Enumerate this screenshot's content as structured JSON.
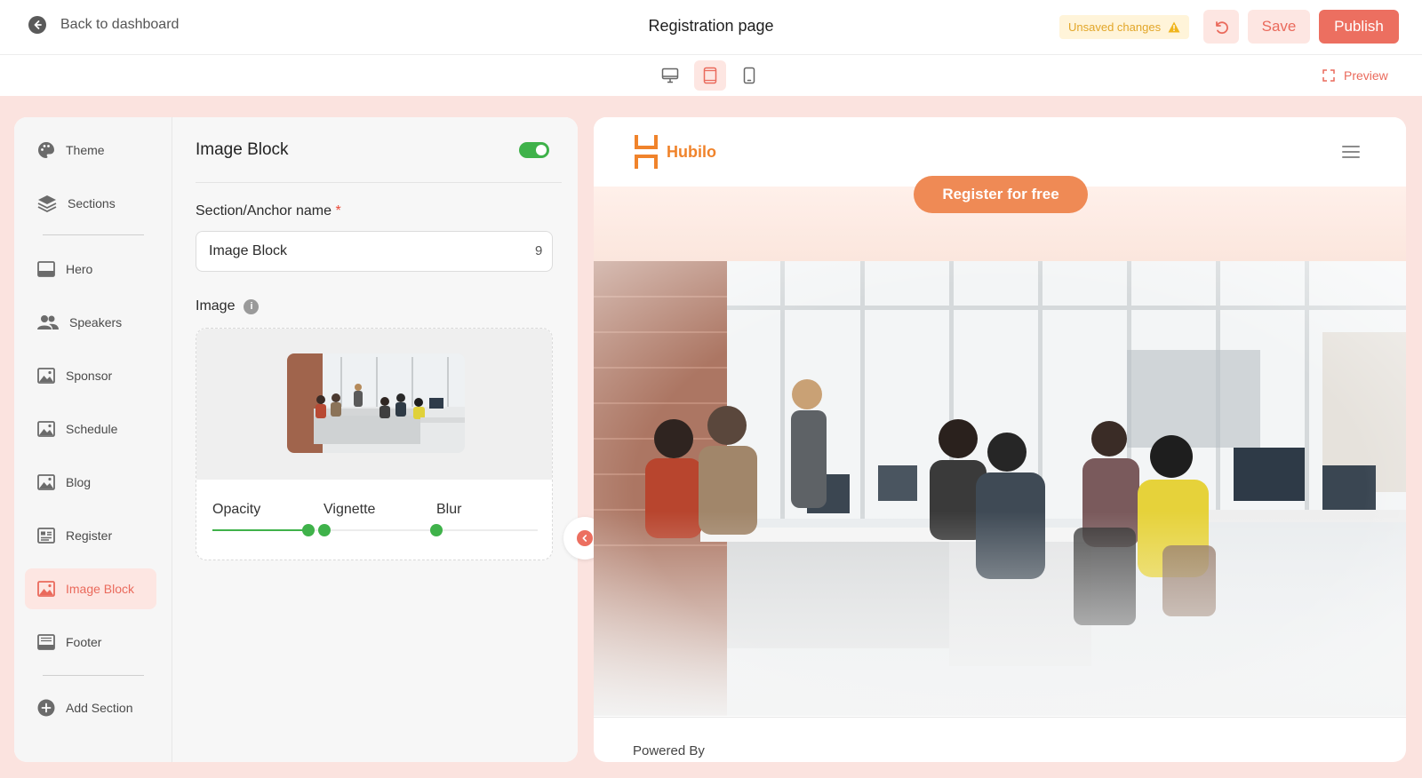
{
  "header": {
    "back_label": "Back to dashboard",
    "title": "Registration page",
    "unsaved_label": "Unsaved changes",
    "save_label": "Save",
    "publish_label": "Publish"
  },
  "device_bar": {
    "devices": [
      "desktop",
      "tablet",
      "mobile"
    ],
    "active_device": "tablet",
    "preview_label": "Preview"
  },
  "sidebar": {
    "items": [
      {
        "label": "Theme",
        "icon": "palette-icon"
      },
      {
        "label": "Sections",
        "icon": "layers-icon"
      },
      {
        "label": "Hero",
        "icon": "hero-layout-icon"
      },
      {
        "label": "Speakers",
        "icon": "people-icon"
      },
      {
        "label": "Sponsor",
        "icon": "image-icon"
      },
      {
        "label": "Schedule",
        "icon": "image-icon"
      },
      {
        "label": "Blog",
        "icon": "image-icon"
      },
      {
        "label": "Register",
        "icon": "form-icon"
      },
      {
        "label": "Image Block",
        "icon": "image-icon",
        "active": true
      },
      {
        "label": "Footer",
        "icon": "footer-layout-icon"
      },
      {
        "label": "Add Section",
        "icon": "plus-circle-icon"
      }
    ]
  },
  "panel": {
    "title": "Image Block",
    "enabled": true,
    "anchor_label": "Section/Anchor name",
    "required_mark": "*",
    "anchor_value": "Image Block",
    "anchor_count": "9",
    "image_label": "Image",
    "info_glyph": "i",
    "sliders": {
      "opacity_label": "Opacity",
      "vignette_label": "Vignette",
      "blur_label": "Blur"
    }
  },
  "preview": {
    "brand": "Hubilo",
    "register_label": "Register for free",
    "powered_by": "Powered By"
  },
  "colors": {
    "accent": "#ec6f60",
    "accent_light": "#fde6e2",
    "toggle_on": "#3fb24a",
    "warning": "#e2a629",
    "brand_orange": "#f0832b",
    "workspace_bg": "#fbe3df"
  }
}
